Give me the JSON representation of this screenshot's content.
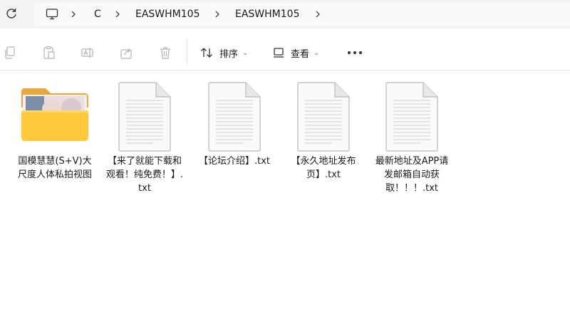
{
  "address": {
    "crumbs": [
      "C",
      "EASWHM105",
      "EASWHM105"
    ]
  },
  "toolbar": {
    "sort_label": "排序",
    "view_label": "查看"
  },
  "files": [
    {
      "name": "国模慧慧(S+V)大尺度人体私拍视图",
      "type": "folder"
    },
    {
      "name": "【来了就能下载和观看！纯免费！】.txt",
      "type": "txt"
    },
    {
      "name": "【论坛介绍】.txt",
      "type": "txt"
    },
    {
      "name": "【永久地址发布页】.txt",
      "type": "txt"
    },
    {
      "name": "最新地址及APP请发邮箱自动获取！！！.txt",
      "type": "txt"
    }
  ],
  "icons": {
    "refresh": "refresh-icon",
    "computer": "computer-icon",
    "copy": "copy-icon",
    "paste": "paste-icon",
    "rename": "rename-icon",
    "share": "share-icon",
    "delete": "delete-icon",
    "sort": "sort-icon",
    "view": "view-icon",
    "more": "more-icon"
  },
  "colors": {
    "folder_back": "#e8a93a",
    "folder_front": "#ffce4a",
    "accent": "#1a1a1a"
  }
}
